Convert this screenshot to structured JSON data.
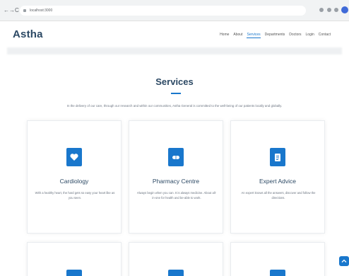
{
  "browser": {
    "back": "←",
    "forward": "→",
    "reload": "C",
    "url": "localhost:3000"
  },
  "header": {
    "logo": "Astha",
    "nav": [
      "Home",
      "About",
      "Services",
      "Departments",
      "Doctors",
      "Login",
      "Contact"
    ],
    "active": "Services"
  },
  "section": {
    "title": "Services",
    "description": "In the delivery of our care, through our research and within our communities, Astha General is committed to the well-being of our patients locally and globally."
  },
  "services": [
    {
      "title": "Cardiology",
      "icon": "heart-icon",
      "description": "With a healthy heart, the hard gets so easy your heart like as you seen."
    },
    {
      "title": "Pharmacy Centre",
      "icon": "pills-icon",
      "description": "Always begin when you can. It is always medicine. About all-in-one for health and be-able to work."
    },
    {
      "title": "Expert Advice",
      "icon": "clipboard-icon",
      "description": "An expert knows all the answers, discover and follow the directions."
    }
  ],
  "colors": {
    "accent": "#1977cc",
    "heading": "#2c4964"
  }
}
